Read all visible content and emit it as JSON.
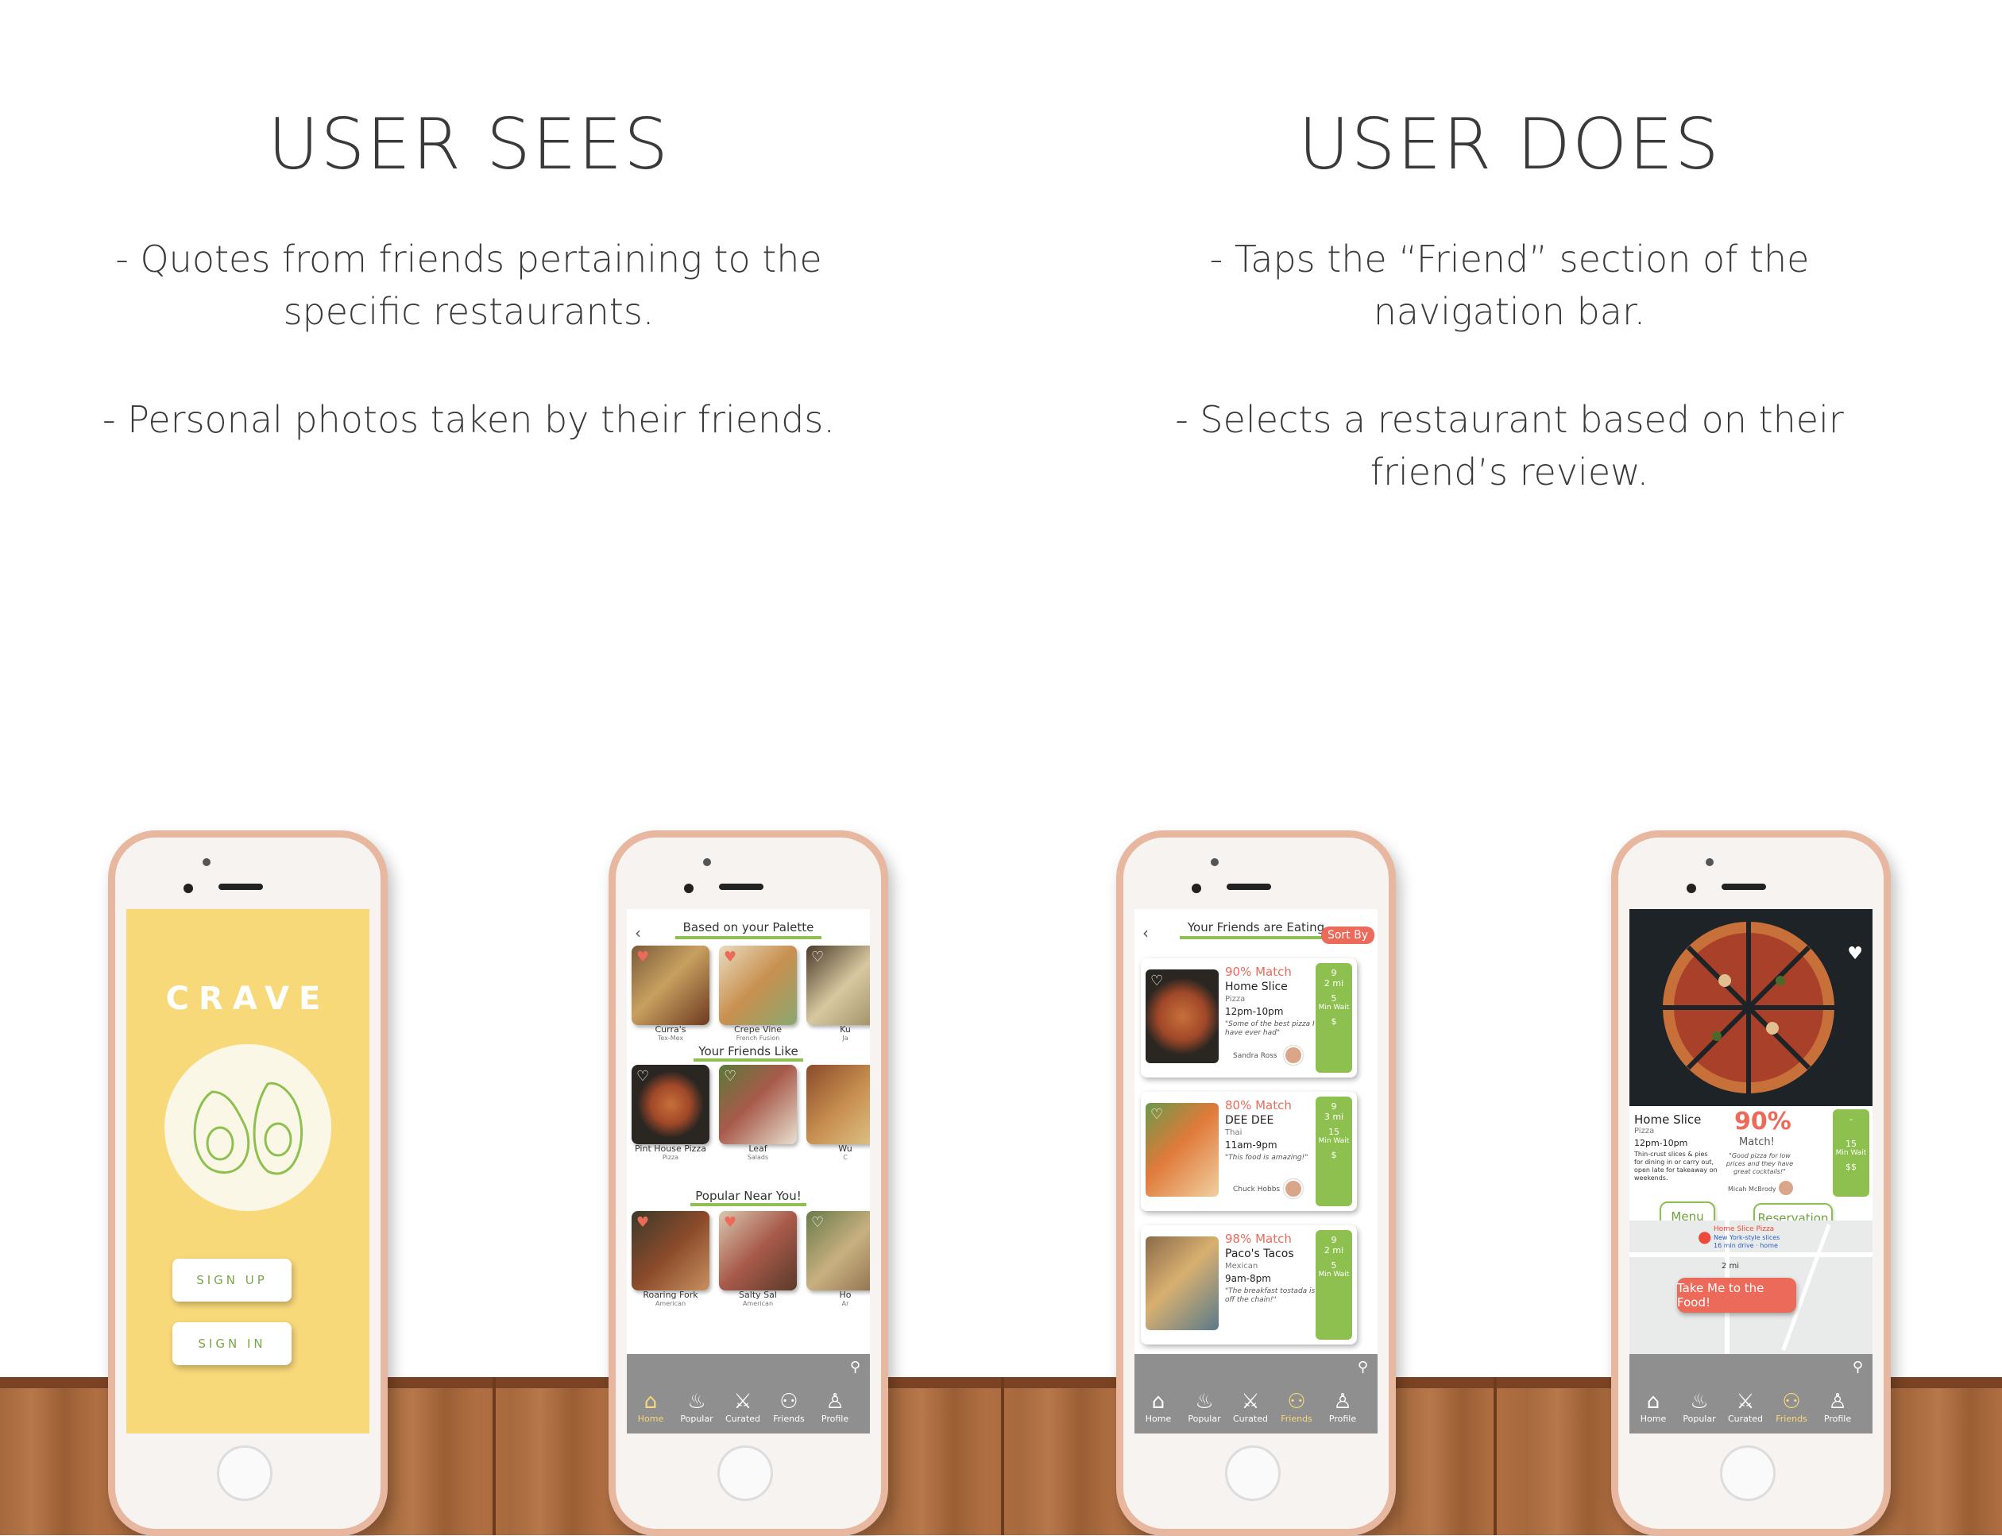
{
  "left": {
    "title": "USER SEES",
    "bullets": [
      "- Quotes from friends pertaining to the specific restaurants.",
      "- Personal photos taken by their friends."
    ]
  },
  "right": {
    "title": "USER DOES",
    "bullets": [
      "- Taps the “Friend” section of the navigation bar.",
      "- Selects a restaurant based on their friend’s review."
    ]
  },
  "screen1": {
    "brand": "CRAVE",
    "signup": "SIGN UP",
    "signin": "SIGN IN"
  },
  "screen2": {
    "section1": "Based on your Palette",
    "section2": "Your Friends Like",
    "section3": "Popular Near You!",
    "row1": [
      {
        "name": "Curra's",
        "cuisine": "Tex-Mex"
      },
      {
        "name": "Crepe Vine",
        "cuisine": "French Fusion"
      },
      {
        "name": "Ku",
        "cuisine": "Ja"
      }
    ],
    "row2": [
      {
        "name": "Pint House Pizza",
        "cuisine": "Pizza"
      },
      {
        "name": "Leaf",
        "cuisine": "Salads"
      },
      {
        "name": "Wu",
        "cuisine": "C"
      }
    ],
    "row3": [
      {
        "name": "Roaring Fork",
        "cuisine": "American"
      },
      {
        "name": "Salty Sal",
        "cuisine": "American"
      },
      {
        "name": "Ho",
        "cuisine": "Ar"
      }
    ]
  },
  "nav": {
    "home": "Home",
    "popular": "Popular",
    "curated": "Curated",
    "friends": "Friends",
    "profile": "Profile"
  },
  "screen3": {
    "title": "Your Friends are Eating",
    "sort": "Sort By",
    "cards": [
      {
        "match": "90% Match",
        "name": "Home Slice",
        "cuisine": "Pizza",
        "hours": "12pm-10pm",
        "quote": "\"Some of the best pizza I have ever had\"",
        "who": "Sandra Ross",
        "dist_val": "9",
        "dist_unit": "2 mi",
        "wait_val": "5",
        "wait_unit": "Min Wait",
        "price": "$"
      },
      {
        "match": "80% Match",
        "name": "DEE DEE",
        "cuisine": "Thai",
        "hours": "11am-9pm",
        "quote": "\"This food is amazing!\"",
        "who": "Chuck Hobbs",
        "dist_val": "9",
        "dist_unit": "3 mi",
        "wait_val": "15",
        "wait_unit": "Min Wait",
        "price": "$"
      },
      {
        "match": "98% Match",
        "name": "Paco's Tacos",
        "cuisine": "Mexican",
        "hours": "9am-8pm",
        "quote": "\"The breakfast tostada is off the chain!\"",
        "who": "",
        "dist_val": "9",
        "dist_unit": "2 mi",
        "wait_val": "5",
        "wait_unit": "Min Wait",
        "price": ""
      }
    ]
  },
  "screen4": {
    "name": "Home Slice",
    "cuisine": "Pizza",
    "hours": "12pm-10pm",
    "desc": "Thin-crust slices & pies for dining in or carry out, open late for takeaway on weekends.",
    "match_pct": "90%",
    "match_label": "Match!",
    "quote": "\"Good pizza for low prices and they have great cocktails!\"",
    "who": "Micah McBrody",
    "dist": "-",
    "wait_val": "15",
    "wait_unit": "Min Wait",
    "price": "$$",
    "menu": "Menu",
    "reservation": "Reservation",
    "map_pin": "Home Slice Pizza",
    "map_sub": "New York-style slices",
    "map_drive": "16 min drive · home",
    "map_dist": "2 mi",
    "cta": "Take Me to the Food!"
  },
  "colors": {
    "accent_green": "#8ec04f",
    "accent_red": "#ec6a5a",
    "crave_yellow": "#f8d97a"
  }
}
